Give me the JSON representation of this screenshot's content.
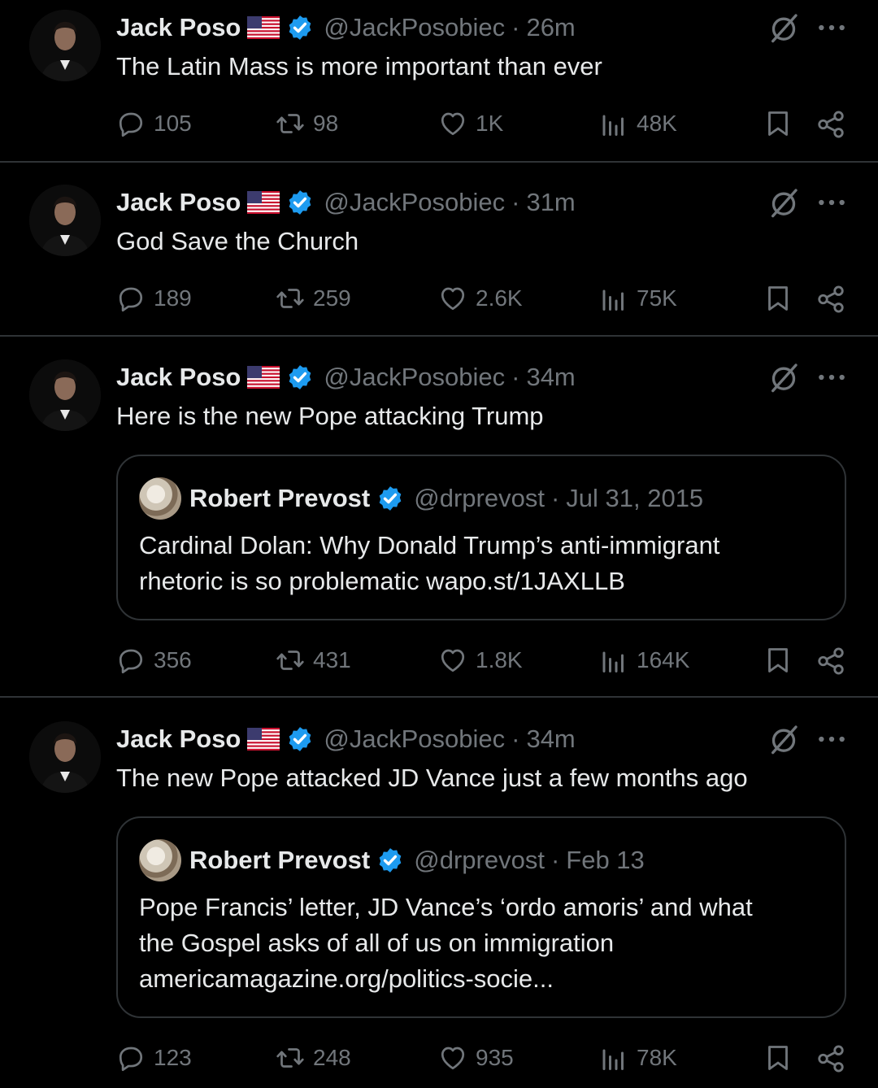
{
  "colors": {
    "background": "#000000",
    "text": "#e7e9ea",
    "muted": "#71767b",
    "verified": "#1d9bf0",
    "divider": "#2f3336"
  },
  "icons": {
    "reply": "speech-bubble-icon",
    "repost": "repost-arrows-icon",
    "like": "heart-icon",
    "views": "bar-chart-icon",
    "bookmark": "bookmark-icon",
    "share": "share-icon",
    "grok": "grok-slash-icon",
    "more": "ellipsis-icon",
    "verified": "verified-badge-icon",
    "flag": "us-flag-icon"
  },
  "tweets": [
    {
      "name": "Jack Poso",
      "handle": "@JackPosobiec",
      "sep": "·",
      "time": "26m",
      "text": "The Latin Mass is more important than ever",
      "replies": "105",
      "reposts": "98",
      "likes": "1K",
      "views": "48K"
    },
    {
      "name": "Jack Poso",
      "handle": "@JackPosobiec",
      "sep": "·",
      "time": "31m",
      "text": "God Save the Church",
      "replies": "189",
      "reposts": "259",
      "likes": "2.6K",
      "views": "75K"
    },
    {
      "name": "Jack Poso",
      "handle": "@JackPosobiec",
      "sep": "·",
      "time": "34m",
      "text": "Here is the new Pope attacking Trump",
      "quote": {
        "name": "Robert Prevost",
        "handle": "@drprevost",
        "sep": "·",
        "time": "Jul 31, 2015",
        "line1": "Cardinal Dolan: Why Donald Trump’s anti-immigrant",
        "line2": "rhetoric is so problematic wapo.st/1JAXLLB"
      },
      "replies": "356",
      "reposts": "431",
      "likes": "1.8K",
      "views": "164K"
    },
    {
      "name": "Jack Poso",
      "handle": "@JackPosobiec",
      "sep": "·",
      "time": "34m",
      "text": "The new Pope attacked JD Vance just a few months ago",
      "quote": {
        "name": "Robert Prevost",
        "handle": "@drprevost",
        "sep": "·",
        "time": "Feb 13",
        "line1": "Pope Francis’ letter, JD Vance’s ‘ordo amoris’ and what",
        "line2": "the Gospel asks of all of us on immigration",
        "line3": "americamagazine.org/politics-socie..."
      },
      "replies": "123",
      "reposts": "248",
      "likes": "935",
      "views": "78K"
    }
  ]
}
